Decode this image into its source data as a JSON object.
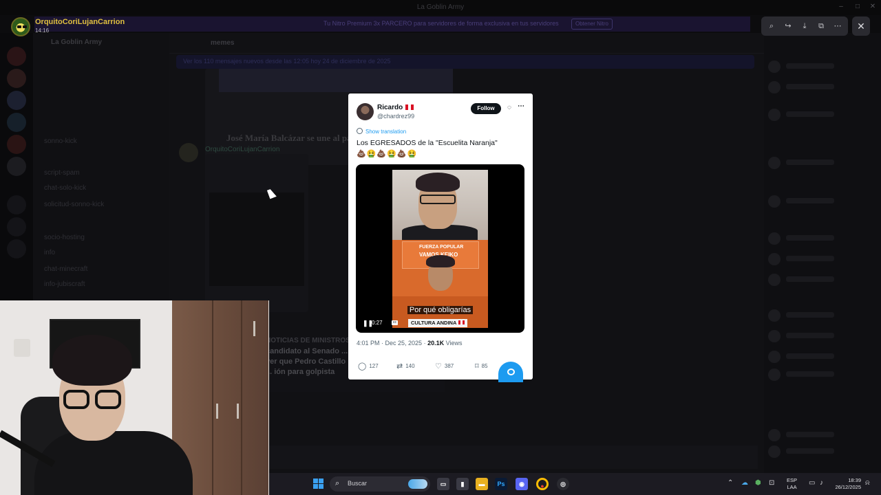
{
  "window": {
    "title": "La Goblin Army"
  },
  "banner": {
    "text": "Tu Nitro Premium 3x PARCERO para servidores de forma exclusiva en tus servidores",
    "button": "Obtener Nitro"
  },
  "background": {
    "server_name": "La Goblin Army",
    "channels": [
      "sonno-kick",
      "script-spam",
      "chat-solo-kick",
      "solicitud-sonno-kick",
      "socio-hosting",
      "info",
      "chat-minecraft",
      "info-jubiscraft"
    ],
    "chat_channel": "memes",
    "pinned_text": "Ver los 110 mensajes nuevos desde las 12:05 hoy 24 de diciembre de 2025",
    "pinned_action": "Marcar como leído",
    "embed_headline": "José María Balcázar se une al partido... en medio de...",
    "message_user": "OrquitoCoriLujanCarrion",
    "second_card_title": "NOTICIAS DE MINISTROS",
    "second_card_body": "candidato al Senado ... ver que Pedro Castillo ... ión para golpista"
  },
  "viewer": {
    "username": "OrquitoCoriLujanCarrion",
    "time": "14:16",
    "tools": [
      "zoom-icon",
      "forward-icon",
      "download-icon",
      "open-external-icon",
      "more-icon"
    ],
    "close": "✕"
  },
  "tweet": {
    "display_name": "Ricardo",
    "handle": "@chardrez99",
    "follow_label": "Follow",
    "show_translation": "Show translation",
    "text": "Los EGRESADOS de la \"Escuelita Naranja\"",
    "emojis": "💩🤮💩🤮💩🤮",
    "video": {
      "caption": "Por qué obligarías",
      "label": "CULTURA ANDINA",
      "time": "0:27",
      "sign_line1": "FUERZA POPULAR",
      "sign_line2": "VAMOS KEIKO"
    },
    "timestamp": "4:01 PM · Dec 25, 2025",
    "views_count": "20.1K",
    "views_label": "Views",
    "replies": "127",
    "reposts": "140",
    "likes": "387",
    "bookmarks": "85"
  },
  "taskbar": {
    "search_placeholder": "Buscar",
    "lang_line1": "ESP",
    "lang_line2": "LAA",
    "time": "18:39",
    "date": "26/12/2025",
    "apps": [
      "File Explorer",
      "Photoshop",
      "Discord",
      "Chrome",
      "OBS"
    ]
  }
}
